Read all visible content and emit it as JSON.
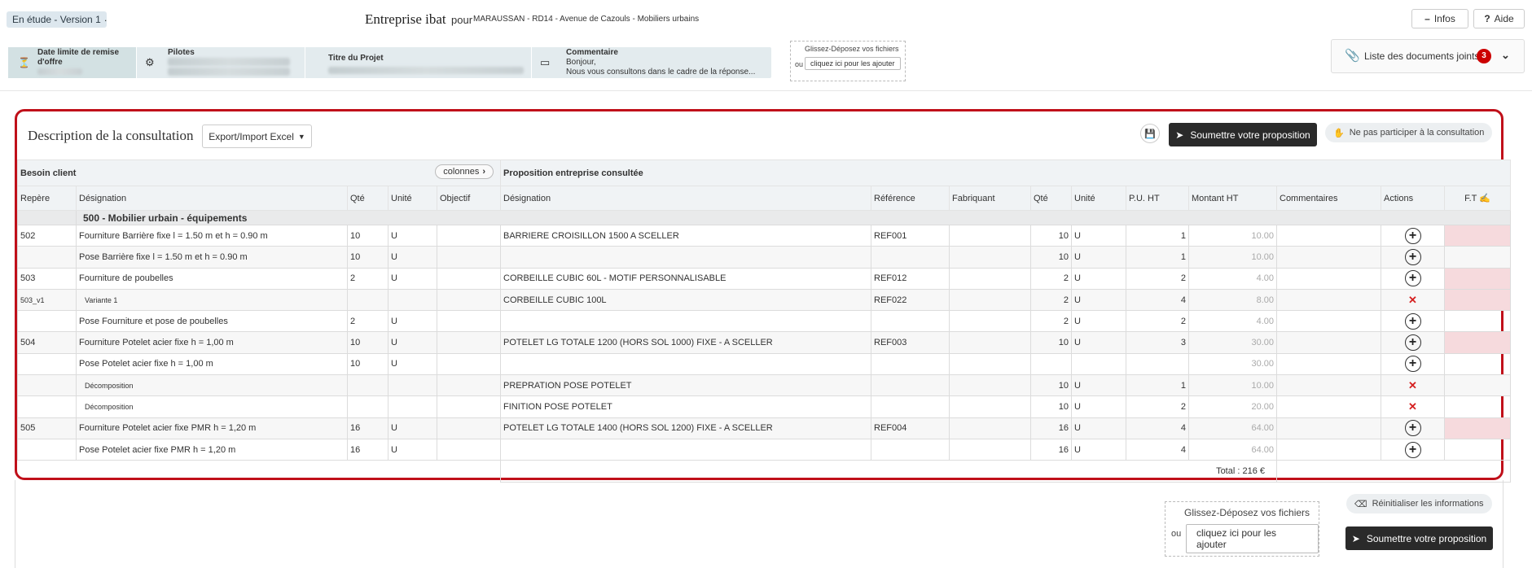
{
  "header": {
    "status": "En étude - Version 1",
    "dot": ".",
    "company": "Entreprise ibat",
    "pour": "pour",
    "project": "MARAUSSAN - RD14 - Avenue de Cazouls - Mobiliers urbains",
    "infos_label": "Infos",
    "aide_label": "Aide"
  },
  "infobar": {
    "deadline_label": "Date limite de remise d'offre",
    "pilots_label": "Pilotes",
    "title_label": "Titre du Projet",
    "comment_label": "Commentaire",
    "comment_line1": "Bonjour,",
    "comment_line2": "Nous vous consultons dans le cadre de la réponse..."
  },
  "upload_small": {
    "drop": "Glissez-Déposez vos fichiers",
    "ou": "ou",
    "click": "cliquez ici pour les ajouter"
  },
  "docs": {
    "label": "Liste des documents joints",
    "count": "3"
  },
  "consultation": {
    "title": "Description de la consultation",
    "export_label": "Export/Import Excel",
    "submit_label": "Soumettre votre proposition",
    "decline_label": "Ne pas participer à la consultation"
  },
  "table": {
    "group_client": "Besoin client",
    "columns_btn": "colonnes",
    "group_entreprise": "Proposition entreprise consultée",
    "headers": [
      "Repère",
      "Désignation",
      "Qté",
      "Unité",
      "Objectif",
      "Désignation",
      "Référence",
      "Fabriquant",
      "Qté",
      "Unité",
      "P.U. HT",
      "Montant HT",
      "Commentaires",
      "Actions",
      "F.T"
    ],
    "section": "500 - Mobilier urbain - équipements",
    "rows": [
      {
        "repere": "502",
        "designation": "Fourniture Barrière fixe l = 1.50 m et h = 0.90 m",
        "qte": "10",
        "unite": "U",
        "objectif": "",
        "p_designation": "BARRIERE CROISILLON 1500 A SCELLER",
        "reference": "REF001",
        "fabriquant": "",
        "p_qte": "10",
        "p_unite": "U",
        "pu": "1",
        "montant": "10.00",
        "commentaires": "",
        "action": "plus"
      },
      {
        "repere": "",
        "designation": "Pose Barrière fixe l = 1.50 m et h = 0.90 m",
        "qte": "10",
        "unite": "U",
        "objectif": "",
        "p_designation": "",
        "reference": "",
        "fabriquant": "",
        "p_qte": "10",
        "p_unite": "U",
        "pu": "1",
        "montant": "10.00",
        "commentaires": "",
        "action": "plus"
      },
      {
        "repere": "503",
        "designation": "Fourniture de poubelles",
        "qte": "2",
        "unite": "U",
        "objectif": "",
        "p_designation": "CORBEILLE CUBIC 60L - MOTIF PERSONNALISABLE",
        "reference": "REF012",
        "fabriquant": "",
        "p_qte": "2",
        "p_unite": "U",
        "pu": "2",
        "montant": "4.00",
        "commentaires": "",
        "action": "plus"
      },
      {
        "repere": "503_v1",
        "designation": "Variante 1",
        "qte": "",
        "unite": "",
        "objectif": "",
        "p_designation": "CORBEILLE CUBIC 100L",
        "reference": "REF022",
        "fabriquant": "",
        "p_qte": "2",
        "p_unite": "U",
        "pu": "4",
        "montant": "8.00",
        "commentaires": "",
        "action": "remove"
      },
      {
        "repere": "",
        "designation": "Pose Fourniture et pose de poubelles",
        "qte": "2",
        "unite": "U",
        "objectif": "",
        "p_designation": "",
        "reference": "",
        "fabriquant": "",
        "p_qte": "2",
        "p_unite": "U",
        "pu": "2",
        "montant": "4.00",
        "commentaires": "",
        "action": "plus"
      },
      {
        "repere": "504",
        "designation": "Fourniture Potelet acier fixe h = 1,00 m",
        "qte": "10",
        "unite": "U",
        "objectif": "",
        "p_designation": "POTELET LG TOTALE 1200 (HORS SOL 1000) FIXE - A SCELLER",
        "reference": "REF003",
        "fabriquant": "",
        "p_qte": "10",
        "p_unite": "U",
        "pu": "3",
        "montant": "30.00",
        "commentaires": "",
        "action": "plus"
      },
      {
        "repere": "",
        "designation": "Pose Potelet acier fixe h = 1,00 m",
        "qte": "10",
        "unite": "U",
        "objectif": "",
        "p_designation": "",
        "reference": "",
        "fabriquant": "",
        "p_qte": "",
        "p_unite": "",
        "pu": "",
        "montant": "30.00",
        "commentaires": "",
        "action": "plus"
      },
      {
        "repere": "",
        "designation": "Décomposition",
        "qte": "",
        "unite": "",
        "objectif": "",
        "p_designation": "PREPRATION POSE POTELET",
        "reference": "",
        "fabriquant": "",
        "p_qte": "10",
        "p_unite": "U",
        "pu": "1",
        "montant": "10.00",
        "commentaires": "",
        "action": "remove"
      },
      {
        "repere": "",
        "designation": "Décomposition",
        "qte": "",
        "unite": "",
        "objectif": "",
        "p_designation": "FINITION POSE POTELET",
        "reference": "",
        "fabriquant": "",
        "p_qte": "10",
        "p_unite": "U",
        "pu": "2",
        "montant": "20.00",
        "commentaires": "",
        "action": "remove"
      },
      {
        "repere": "505",
        "designation": "Fourniture Potelet acier fixe PMR h = 1,20 m",
        "qte": "16",
        "unite": "U",
        "objectif": "",
        "p_designation": "POTELET  LG TOTALE 1400 (HORS SOL 1200) FIXE - A SCELLER",
        "reference": "REF004",
        "fabriquant": "",
        "p_qte": "16",
        "p_unite": "U",
        "pu": "4",
        "montant": "64.00",
        "commentaires": "",
        "action": "plus"
      },
      {
        "repere": "",
        "designation": "Pose Potelet acier fixe PMR h = 1,20 m",
        "qte": "16",
        "unite": "U",
        "objectif": "",
        "p_designation": "",
        "reference": "",
        "fabriquant": "",
        "p_qte": "16",
        "p_unite": "U",
        "pu": "4",
        "montant": "64.00",
        "commentaires": "",
        "action": "plus"
      }
    ],
    "total": "Total : 216 €"
  },
  "footer": {
    "reset_label": "Réinitialiser les informations",
    "drop": "Glissez-Déposez vos fichiers",
    "ou": "ou",
    "click": "cliquez ici pour les ajouter",
    "submit_label": "Soumettre votre proposition"
  },
  "colors": {
    "frame": "#c0101a",
    "badge": "#cc0000",
    "dark_button": "#2a2a2a",
    "pink_cell": "#f6dadd"
  }
}
